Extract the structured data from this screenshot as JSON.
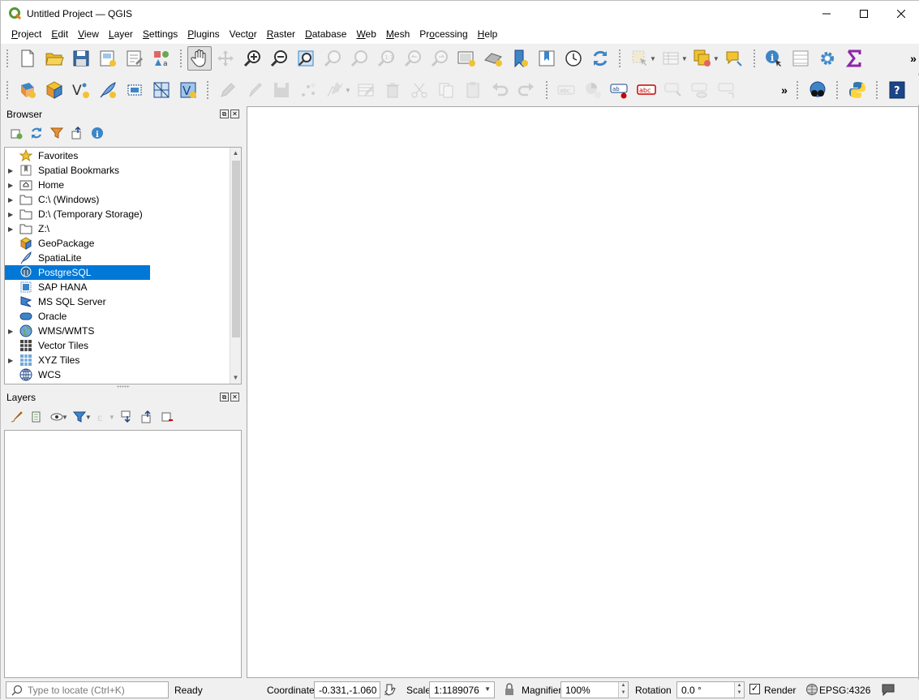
{
  "window": {
    "title": "Untitled Project — QGIS"
  },
  "menubar": {
    "items": [
      {
        "label": "Project",
        "ul": "P",
        "rest": "roject"
      },
      {
        "label": "Edit",
        "ul": "E",
        "rest": "dit"
      },
      {
        "label": "View",
        "ul": "V",
        "rest": "iew"
      },
      {
        "label": "Layer",
        "ul": "L",
        "rest": "ayer"
      },
      {
        "label": "Settings",
        "ul": "S",
        "rest": "ettings"
      },
      {
        "label": "Plugins",
        "ul": "P",
        "rest": "lugins"
      },
      {
        "label": "Vector",
        "ul": "o",
        "pre": "Vect",
        "rest": "r"
      },
      {
        "label": "Raster",
        "ul": "R",
        "rest": "aster"
      },
      {
        "label": "Database",
        "ul": "D",
        "rest": "atabase"
      },
      {
        "label": "Web",
        "ul": "W",
        "rest": "eb"
      },
      {
        "label": "Mesh",
        "ul": "M",
        "rest": "esh"
      },
      {
        "label": "Processing",
        "ul": "o",
        "pre": "Pr",
        "rest": "cessing"
      },
      {
        "label": "Help",
        "ul": "H",
        "rest": "elp"
      }
    ]
  },
  "toolbar_more": "»",
  "browser": {
    "title": "Browser",
    "items": [
      {
        "label": "Favorites",
        "icon": "star-icon",
        "expand": false
      },
      {
        "label": "Spatial Bookmarks",
        "icon": "bookmark-icon",
        "expand": true
      },
      {
        "label": "Home",
        "icon": "home-folder-icon",
        "expand": true
      },
      {
        "label": "C:\\ (Windows)",
        "icon": "folder-icon",
        "expand": true
      },
      {
        "label": "D:\\ (Temporary Storage)",
        "icon": "folder-icon",
        "expand": true
      },
      {
        "label": "Z:\\",
        "icon": "folder-icon",
        "expand": true
      },
      {
        "label": "GeoPackage",
        "icon": "geopackage-icon",
        "expand": false
      },
      {
        "label": "SpatiaLite",
        "icon": "spatialite-icon",
        "expand": false
      },
      {
        "label": "PostgreSQL",
        "icon": "postgresql-icon",
        "expand": false,
        "selected": true
      },
      {
        "label": "SAP HANA",
        "icon": "sap-hana-icon",
        "expand": false
      },
      {
        "label": "MS SQL Server",
        "icon": "mssql-icon",
        "expand": false
      },
      {
        "label": "Oracle",
        "icon": "oracle-icon",
        "expand": false
      },
      {
        "label": "WMS/WMTS",
        "icon": "globe-icon",
        "expand": true
      },
      {
        "label": "Vector Tiles",
        "icon": "vector-tiles-icon",
        "expand": false
      },
      {
        "label": "XYZ Tiles",
        "icon": "xyz-tiles-icon",
        "expand": true
      },
      {
        "label": "WCS",
        "icon": "wcs-globe-icon",
        "expand": false
      }
    ]
  },
  "layers": {
    "title": "Layers"
  },
  "statusbar": {
    "locate_placeholder": "Type to locate (Ctrl+K)",
    "status": "Ready",
    "coordinate_label": "Coordinate",
    "coordinate_value": "-0.331,-1.060",
    "scale_label": "Scale",
    "scale_value": "1:1189076",
    "magnifier_label": "Magnifier",
    "magnifier_value": "100%",
    "rotation_label": "Rotation",
    "rotation_value": "0.0 °",
    "render_label": "Render",
    "render_checked": true,
    "crs": "EPSG:4326"
  },
  "colors": {
    "selection": "#0078d7",
    "qgis_green": "#589632",
    "folder_yellow": "#f1c232"
  }
}
